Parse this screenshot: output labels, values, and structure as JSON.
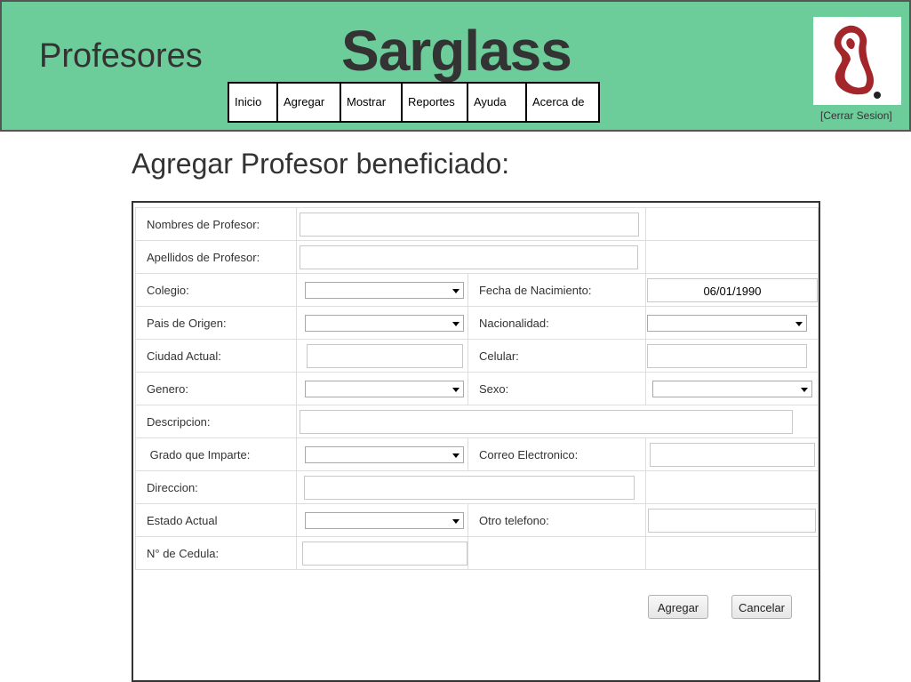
{
  "header": {
    "section_title": "Profesores",
    "brand": "Sarglass",
    "logout": "[Cerrar Sesion]",
    "nav": [
      {
        "label": "Inicio",
        "w": 55
      },
      {
        "label": "Agregar",
        "w": 71
      },
      {
        "label": "Mostrar",
        "w": 69
      },
      {
        "label": "Reportes",
        "w": 74
      },
      {
        "label": "Ayuda",
        "w": 66
      },
      {
        "label": "Acerca de",
        "w": 82
      }
    ]
  },
  "page_title": "Agregar Profesor beneficiado:",
  "form": {
    "nombres": "Nombres de Profesor:",
    "apellidos": "Apellidos de Profesor:",
    "colegio": "Colegio:",
    "fecha_nacimiento": "Fecha de Nacimiento:",
    "fecha_value": "06/01/1990",
    "pais": "Pais de Origen:",
    "nacionalidad": "Nacionalidad:",
    "ciudad": "Ciudad Actual:",
    "celular": "Celular:",
    "genero": "Genero:",
    "sexo": "Sexo:",
    "descripcion": "Descripcion:",
    "grado": " Grado que Imparte:",
    "correo": "Correo Electronico:",
    "direccion": "Direccion:",
    "estado": "Estado Actual",
    "otro_telefono": "Otro telefono:",
    "cedula": "N° de Cedula:",
    "agregar_btn": "Agregar",
    "cancelar_btn": "Cancelar"
  },
  "colors": {
    "header_bg": "#6ccd9a",
    "logo_red": "#a3262a"
  }
}
